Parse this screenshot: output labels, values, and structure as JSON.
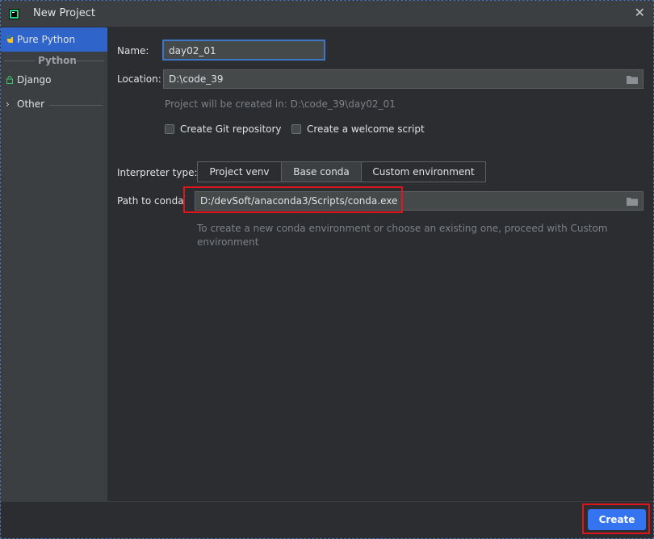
{
  "window": {
    "title": "New Project"
  },
  "sidebar": {
    "items": [
      {
        "label": "Pure Python",
        "selected": true
      },
      {
        "label": "Django"
      },
      {
        "label": "Other"
      }
    ],
    "section_header": "Python"
  },
  "form": {
    "name_label": "Name:",
    "name_value": "day02_01",
    "location_label": "Location:",
    "location_value": "D:\\code_39",
    "project_hint": "Project will be created in: D:\\code_39\\day02_01",
    "git_checkbox_label": "Create Git repository",
    "git_checked": false,
    "welcome_checkbox_label": "Create a welcome script",
    "welcome_checked": false,
    "interpreter_label": "Interpreter type:",
    "interpreter_options": [
      "Project venv",
      "Base conda",
      "Custom environment"
    ],
    "interpreter_selected": "Base conda",
    "conda_label": "Path to conda",
    "conda_value": "D:/devSoft/anaconda3/Scripts/conda.exe",
    "conda_hint_line1": "To create a new conda environment or choose an existing one, proceed with Custom",
    "conda_hint_line2": "environment"
  },
  "footer": {
    "create_label": "Create"
  },
  "colors": {
    "accent": "#3574f0",
    "selected_sidebar": "#2f65ca",
    "highlight": "#e0151b"
  }
}
